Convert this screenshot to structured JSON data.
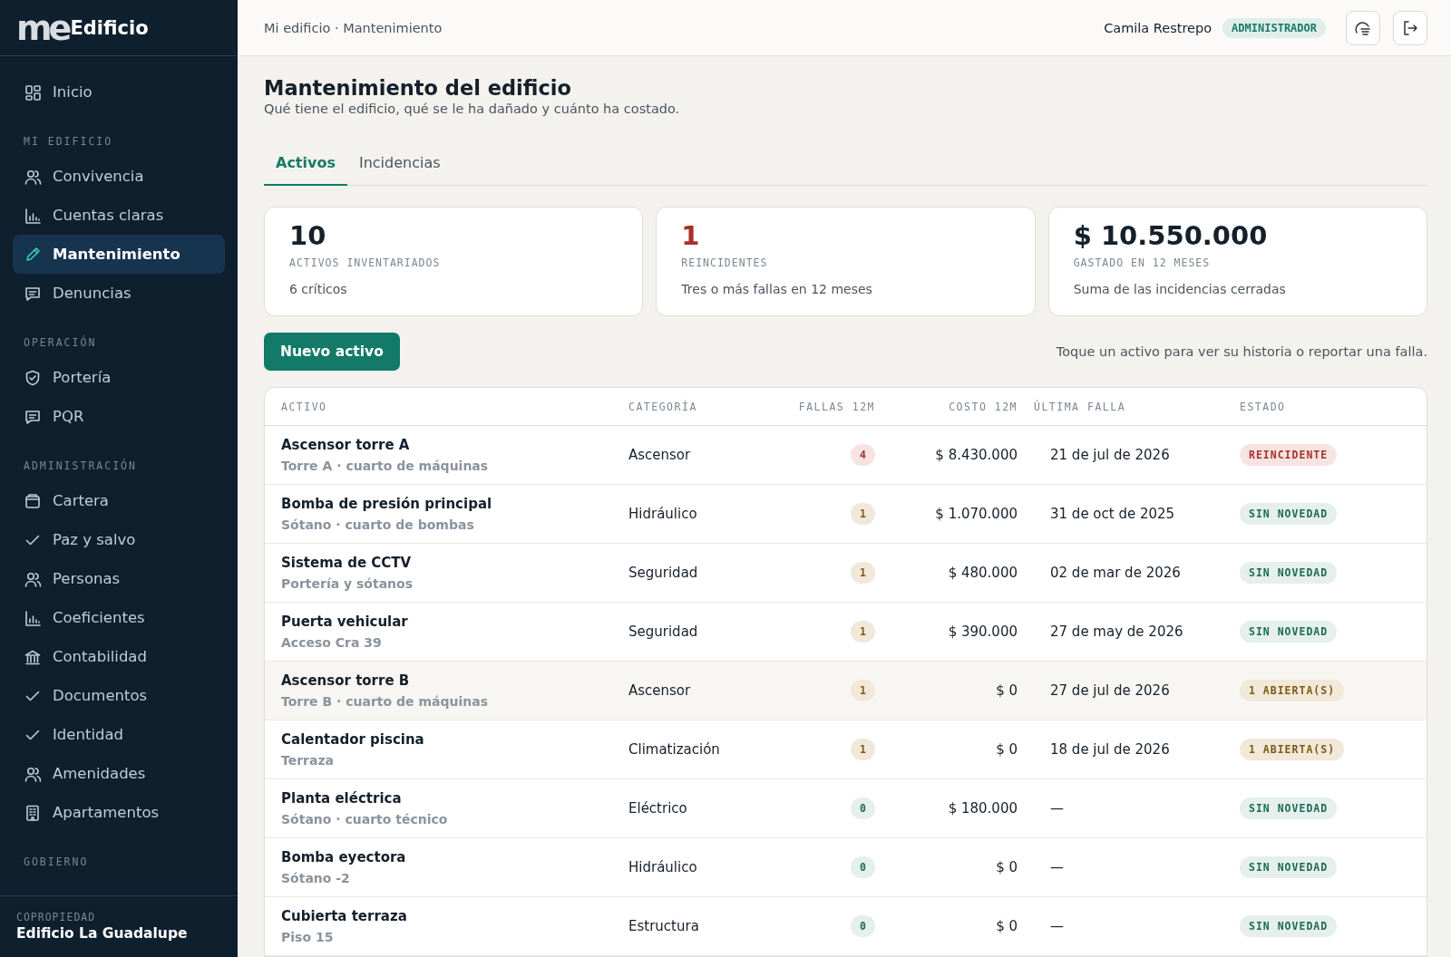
{
  "sidebar": {
    "logo": {
      "mark": "me",
      "name": "Edificio"
    },
    "sections": [
      {
        "items": [
          {
            "label": "Inicio",
            "selected": false
          }
        ]
      },
      {
        "title": "MI EDIFICIO",
        "items": [
          {
            "label": "Convivencia",
            "selected": false
          },
          {
            "label": "Cuentas claras",
            "selected": false
          },
          {
            "label": "Mantenimiento",
            "selected": true
          },
          {
            "label": "Denuncias",
            "selected": false
          }
        ]
      },
      {
        "title": "OPERACIÓN",
        "items": [
          {
            "label": "Portería",
            "selected": false
          },
          {
            "label": "PQR",
            "selected": false
          }
        ]
      },
      {
        "title": "ADMINISTRACIÓN",
        "items": [
          {
            "label": "Cartera",
            "selected": false
          },
          {
            "label": "Paz y salvo",
            "selected": false
          },
          {
            "label": "Personas",
            "selected": false
          },
          {
            "label": "Coeficientes",
            "selected": false
          },
          {
            "label": "Contabilidad",
            "selected": false
          },
          {
            "label": "Documentos",
            "selected": false
          },
          {
            "label": "Identidad",
            "selected": false
          },
          {
            "label": "Amenidades",
            "selected": false
          },
          {
            "label": "Apartamentos",
            "selected": false
          }
        ]
      },
      {
        "title": "GOBIERNO"
      }
    ],
    "footer": {
      "caption": "COPROPIEDAD",
      "name": "Edificio La Guadalupe"
    }
  },
  "header": {
    "breadcrumb": "Mi edificio · Mantenimiento",
    "user": "Camila Restrepo",
    "role": "ADMINISTRADOR"
  },
  "page": {
    "title": "Mantenimiento del edificio",
    "subtitle": "Qué tiene el edificio, qué se le ha dañado y cuánto ha costado."
  },
  "tabs": [
    {
      "label": "Activos",
      "selected": true
    },
    {
      "label": "Incidencias",
      "selected": false
    }
  ],
  "metrics": [
    {
      "value": "10",
      "kind": "plain",
      "label": "ACTIVOS INVENTARIADOS",
      "note": "6 críticos"
    },
    {
      "value": "1",
      "kind": "alert",
      "label": "REINCIDENTES",
      "note": "Tres o más fallas en 12 meses"
    },
    {
      "value": "$ 10.550.000",
      "kind": "plain",
      "label": "GASTADO EN 12 MESES",
      "note": "Suma de las incidencias cerradas"
    }
  ],
  "actions": {
    "button": "Nuevo activo",
    "hint": "Toque un activo para ver su historia o reportar una falla."
  },
  "table": {
    "columns": [
      "ACTIVO",
      "CATEGORÍA",
      "FALLAS 12M",
      "COSTO 12M",
      "ÚLTIMA FALLA",
      "ESTADO"
    ],
    "rows": [
      {
        "name": "Ascensor torre A",
        "location": "Torre A · cuarto de máquinas",
        "category": "Ascensor",
        "failures": {
          "text": "4",
          "kind": "alert"
        },
        "cost": "$ 8.430.000",
        "last": "21 de jul de 2026",
        "status": {
          "text": "REINCIDENTE",
          "kind": "alert"
        },
        "highlighted": false
      },
      {
        "name": "Bomba de presión principal",
        "location": "Sótano · cuarto de bombas",
        "category": "Hidráulico",
        "failures": {
          "text": "1",
          "kind": "warn"
        },
        "cost": "$ 1.070.000",
        "last": "31 de oct de 2025",
        "status": {
          "text": "SIN NOVEDAD",
          "kind": "ok"
        },
        "highlighted": false
      },
      {
        "name": "Sistema de CCTV",
        "location": "Portería y sótanos",
        "category": "Seguridad",
        "failures": {
          "text": "1",
          "kind": "warn"
        },
        "cost": "$ 480.000",
        "last": "02 de mar de 2026",
        "status": {
          "text": "SIN NOVEDAD",
          "kind": "ok"
        },
        "highlighted": false
      },
      {
        "name": "Puerta vehicular",
        "location": "Acceso Cra 39",
        "category": "Seguridad",
        "failures": {
          "text": "1",
          "kind": "warn"
        },
        "cost": "$ 390.000",
        "last": "27 de may de 2026",
        "status": {
          "text": "SIN NOVEDAD",
          "kind": "ok"
        },
        "highlighted": false
      },
      {
        "name": "Ascensor torre B",
        "location": "Torre B · cuarto de máquinas",
        "category": "Ascensor",
        "failures": {
          "text": "1",
          "kind": "warn"
        },
        "cost": "$ 0",
        "last": "27 de jul de 2026",
        "status": {
          "text": "1 ABIERTA(S)",
          "kind": "warn"
        },
        "highlighted": true
      },
      {
        "name": "Calentador piscina",
        "location": "Terraza",
        "category": "Climatización",
        "failures": {
          "text": "1",
          "kind": "warn"
        },
        "cost": "$ 0",
        "last": "18 de jul de 2026",
        "status": {
          "text": "1 ABIERTA(S)",
          "kind": "warn"
        },
        "highlighted": false
      },
      {
        "name": "Planta eléctrica",
        "location": "Sótano · cuarto técnico",
        "category": "Eléctrico",
        "failures": {
          "text": "0",
          "kind": "ok"
        },
        "cost": "$ 180.000",
        "last": "—",
        "status": {
          "text": "SIN NOVEDAD",
          "kind": "ok"
        },
        "highlighted": false
      },
      {
        "name": "Bomba eyectora",
        "location": "Sótano -2",
        "category": "Hidráulico",
        "failures": {
          "text": "0",
          "kind": "ok"
        },
        "cost": "$ 0",
        "last": "—",
        "status": {
          "text": "SIN NOVEDAD",
          "kind": "ok"
        },
        "highlighted": false
      },
      {
        "name": "Cubierta terraza",
        "location": "Piso 15",
        "category": "Estructura",
        "failures": {
          "text": "0",
          "kind": "ok"
        },
        "cost": "$ 0",
        "last": "—",
        "status": {
          "text": "SIN NOVEDAD",
          "kind": "ok"
        },
        "highlighted": false
      }
    ]
  }
}
